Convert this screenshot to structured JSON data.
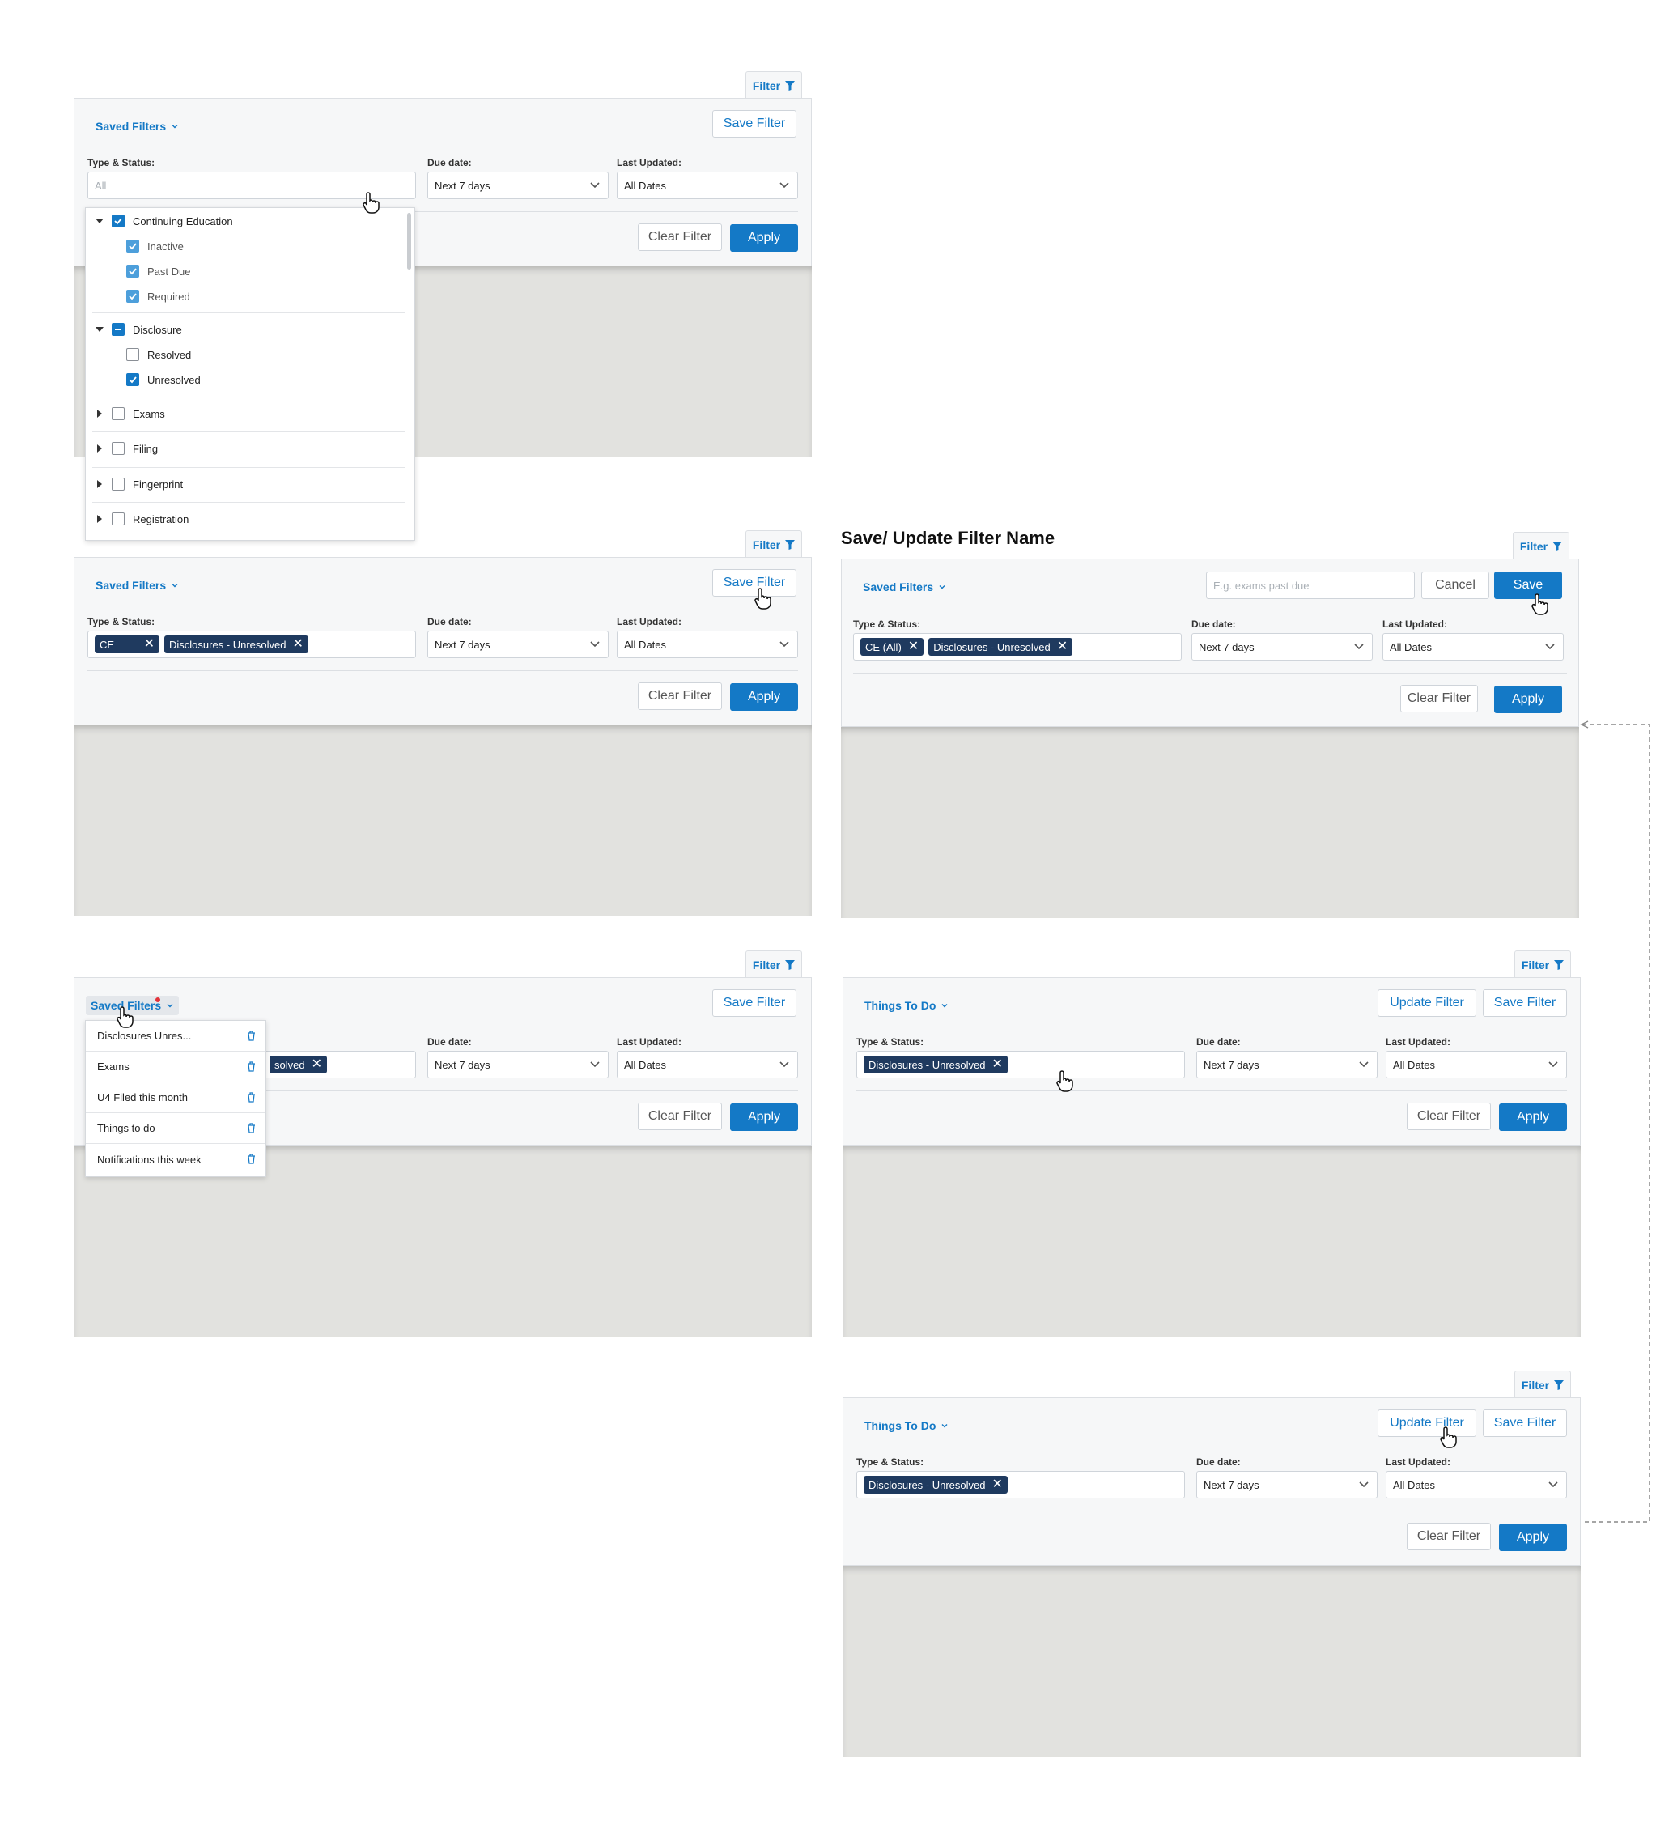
{
  "common": {
    "filter_tab": "Filter",
    "saved_filters": "Saved Filters",
    "save_filter": "Save Filter",
    "update_filter": "Update Filter",
    "clear_filter": "Clear Filter",
    "apply": "Apply",
    "type_status_label": "Type & Status:",
    "due_date_label": "Due date:",
    "last_updated_label": "Last Updated:",
    "due_date_value": "Next 7 days",
    "last_updated_value": "All Dates",
    "things_to_do": "Things To Do",
    "colors": {
      "accent": "#1479c6",
      "chip": "#1f3a5f",
      "panel_bg": "#f6f7f8",
      "content_bg": "#e2e2df"
    }
  },
  "panel1": {
    "type_placeholder": "All",
    "tree": [
      {
        "label": "Continuing Education",
        "state": "checked",
        "expanded": true,
        "children": [
          {
            "label": "Inactive",
            "state": "checked"
          },
          {
            "label": "Past Due",
            "state": "checked"
          },
          {
            "label": "Required",
            "state": "checked"
          }
        ]
      },
      {
        "label": "Disclosure",
        "state": "indeterminate",
        "expanded": true,
        "children": [
          {
            "label": "Resolved",
            "state": "unchecked"
          },
          {
            "label": "Unresolved",
            "state": "checked"
          }
        ]
      },
      {
        "label": "Exams",
        "state": "unchecked",
        "expanded": false
      },
      {
        "label": "Filing",
        "state": "unchecked",
        "expanded": false
      },
      {
        "label": "Fingerprint",
        "state": "unchecked",
        "expanded": false
      },
      {
        "label": "Registration",
        "state": "unchecked",
        "expanded": false
      }
    ]
  },
  "panel2": {
    "chips": [
      "CE",
      "Disclosures - Unresolved"
    ]
  },
  "panel3": {
    "heading": "Save/ Update Filter Name",
    "name_placeholder": "E.g. exams past due",
    "cancel": "Cancel",
    "save": "Save",
    "chips": [
      "CE (All)",
      "Disclosures - Unresolved"
    ]
  },
  "panel4": {
    "partial_chip": "solved",
    "menu_items": [
      "Disclosures Unres...",
      "Exams",
      "U4 Filed this month",
      "Things to do",
      "Notifications this week"
    ]
  },
  "panel5": {
    "chips": [
      "Disclosures - Unresolved"
    ]
  },
  "panel6": {
    "chips": [
      "Disclosures - Unresolved"
    ]
  }
}
